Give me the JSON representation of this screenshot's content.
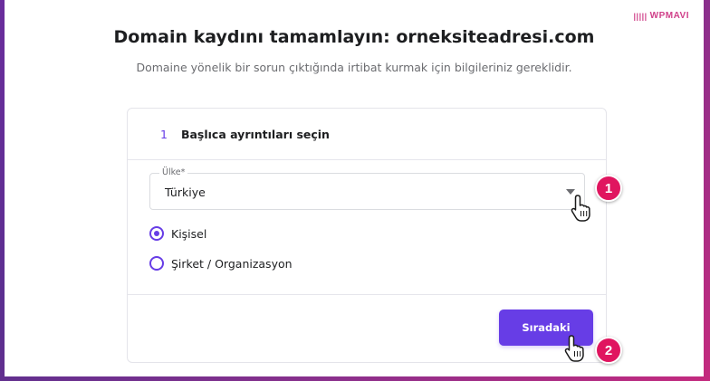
{
  "watermark": {
    "text": "WPMAVI",
    "mark": "|||||"
  },
  "header": {
    "title": "Domain kaydını tamamlayın: orneksiteadresi.com",
    "subtitle": "Domaine yönelik bir sorun çıktığında irtibat kurmak için bilgileriniz gereklidir."
  },
  "step": {
    "number": "1",
    "title": "Başlıca ayrıntıları seçin"
  },
  "country_select": {
    "label": "Ülke*",
    "value": "Türkiye"
  },
  "account_type": {
    "options": [
      {
        "label": "Kişisel",
        "checked": true
      },
      {
        "label": "Şirket / Organizasyon",
        "checked": false
      }
    ]
  },
  "actions": {
    "next_label": "Sıradaki"
  },
  "annotations": {
    "badge_1": "1",
    "badge_2": "2",
    "badge_color": "#e0155f"
  },
  "colors": {
    "accent": "#673de6",
    "frame_gradient": [
      "#6a2d9c",
      "#c42a7e"
    ]
  }
}
